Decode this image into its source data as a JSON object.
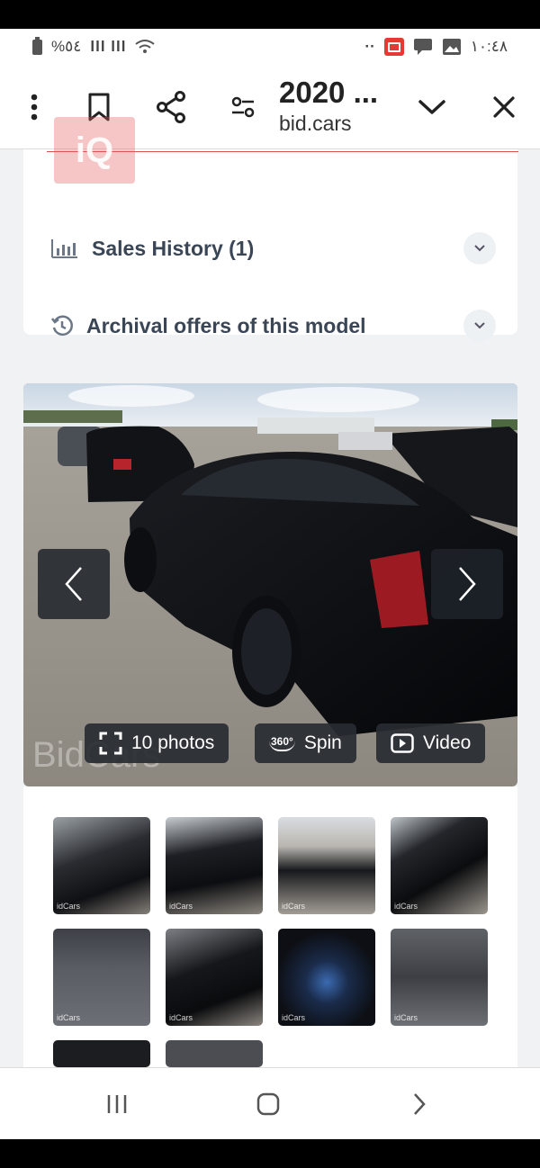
{
  "status_bar": {
    "left_text": "%٥٤",
    "signal": "lll lll",
    "time": "١٠:٤٨",
    "dots": "··"
  },
  "toolbar": {
    "title": "2020 ...",
    "site": "bid.cars"
  },
  "watermark": {
    "text": "iQ"
  },
  "info": {
    "sales_history": "Sales History (1)",
    "archival": "Archival offers of this model"
  },
  "gallery": {
    "photos_label": "10 photos",
    "spin_label": "Spin",
    "spin_badge": "360°",
    "video_label": "Video",
    "watermark": "BidCars"
  },
  "thumbnails": {
    "tag": "idCars"
  },
  "colors": {
    "accent_red": "#d9534f",
    "text_dark": "#3a4656",
    "pill_bg": "#282c32"
  }
}
